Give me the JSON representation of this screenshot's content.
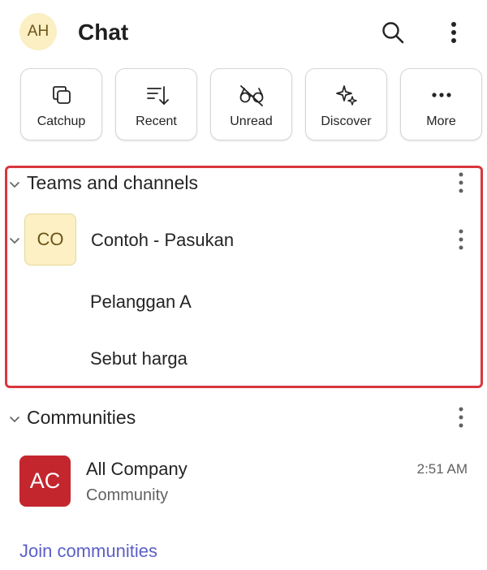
{
  "header": {
    "avatar_initials": "AH",
    "title": "Chat",
    "search_icon": "search-icon",
    "more_icon": "more-vertical-icon"
  },
  "filters": [
    {
      "label": "Catchup",
      "icon": "catchup-icon"
    },
    {
      "label": "Recent",
      "icon": "recent-sort-icon"
    },
    {
      "label": "Unread",
      "icon": "unread-glasses-icon"
    },
    {
      "label": "Discover",
      "icon": "sparkle-icon"
    },
    {
      "label": "More",
      "icon": "more-horizontal-icon"
    }
  ],
  "teams_section": {
    "title": "Teams and channels",
    "team": {
      "avatar_initials": "CO",
      "name": "Contoh - Pasukan",
      "channels": [
        "Pelanggan A",
        "Sebut harga"
      ]
    }
  },
  "communities_section": {
    "title": "Communities",
    "items": [
      {
        "avatar_initials": "AC",
        "name": "All Company",
        "subtitle": "Community",
        "time": "2:51 AM"
      }
    ],
    "join_link": "Join communities"
  },
  "colors": {
    "highlight": "#d9363e",
    "link": "#5b5fc7",
    "community_avatar": "#c4262e",
    "avatar_yellow": "#fbefc3"
  }
}
